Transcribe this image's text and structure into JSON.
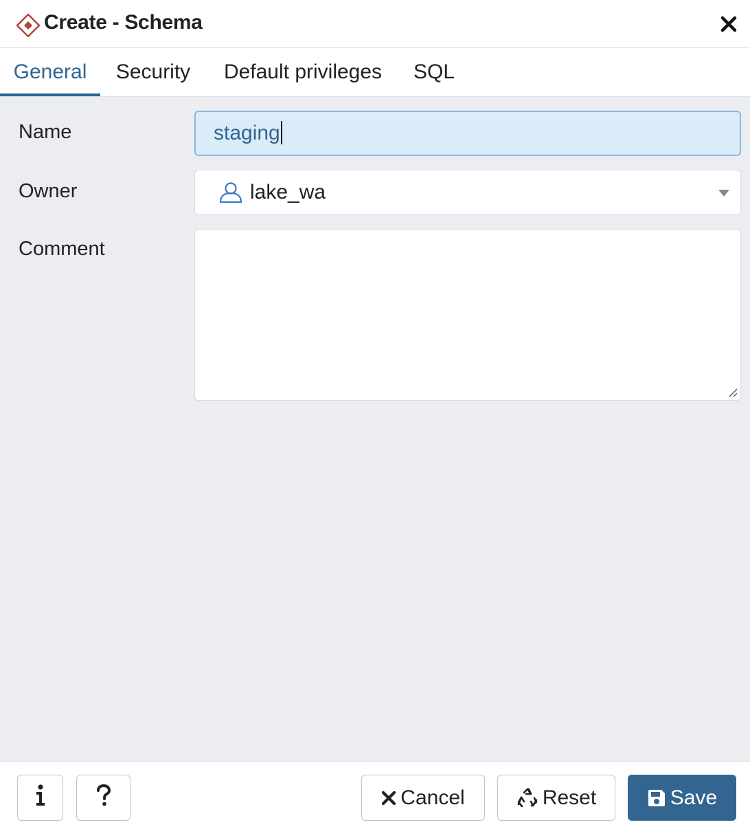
{
  "dialog": {
    "title": "Create - Schema",
    "icons": {
      "title": "schema-icon",
      "close": "close-icon"
    }
  },
  "tabs": [
    {
      "label": "General",
      "active": true
    },
    {
      "label": "Security",
      "active": false
    },
    {
      "label": "Default privileges",
      "active": false
    },
    {
      "label": "SQL",
      "active": false
    }
  ],
  "form": {
    "name": {
      "label": "Name",
      "value": "staging"
    },
    "owner": {
      "label": "Owner",
      "value": "lake_wa",
      "icon": "user-icon"
    },
    "comment": {
      "label": "Comment",
      "value": ""
    }
  },
  "footer": {
    "info_icon": "info-icon",
    "help_icon": "help-icon",
    "cancel_label": "Cancel",
    "reset_label": "Reset",
    "save_label": "Save"
  },
  "colors": {
    "accent": "#326690",
    "input_focus_bg": "#dbecf9",
    "background": "#ebedf1"
  }
}
